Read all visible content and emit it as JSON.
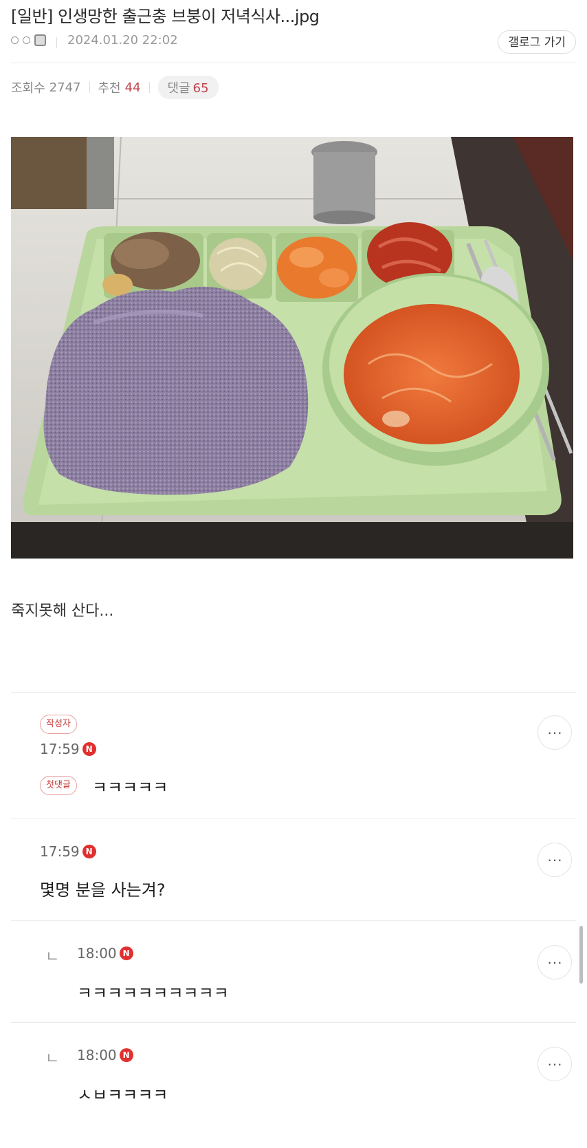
{
  "post": {
    "title": "[일반] 인생망한 출근충 브붕이 저녁식사...jpg",
    "date": "2024.01.20 22:02",
    "gallog_button": "갤로그 가기",
    "views_label": "조회수",
    "views": "2747",
    "recommend_label": "추천",
    "recommend": "44",
    "comments_label": "댓글",
    "comments": "65",
    "body": "죽지못해 산다..."
  },
  "icons": {
    "more": "more-dots-icon",
    "new": "new-badge-icon",
    "reply": "reply-arrow-icon",
    "member": "member-icon"
  },
  "colors": {
    "accent": "#c0404a",
    "new_badge": "#e0302f"
  },
  "comments": [
    {
      "badge": "작성자",
      "time": "17:59",
      "new_badge": "N",
      "tag": "첫댓글",
      "text": "ㅋㅋㅋㅋㅋ"
    },
    {
      "time": "17:59",
      "new_badge": "N",
      "text": "몇명 분을 사는겨?"
    },
    {
      "reply_mark": "ㄴ",
      "time": "18:00",
      "new_badge": "N",
      "text": "ㅋㅋㅋㅋㅋㅋㅋㅋㅋㅋ"
    },
    {
      "reply_mark": "ㄴ",
      "time": "18:00",
      "new_badge": "N",
      "text": "ㅅㅂㅋㅋㅋㅋ"
    }
  ],
  "more_label": "···"
}
